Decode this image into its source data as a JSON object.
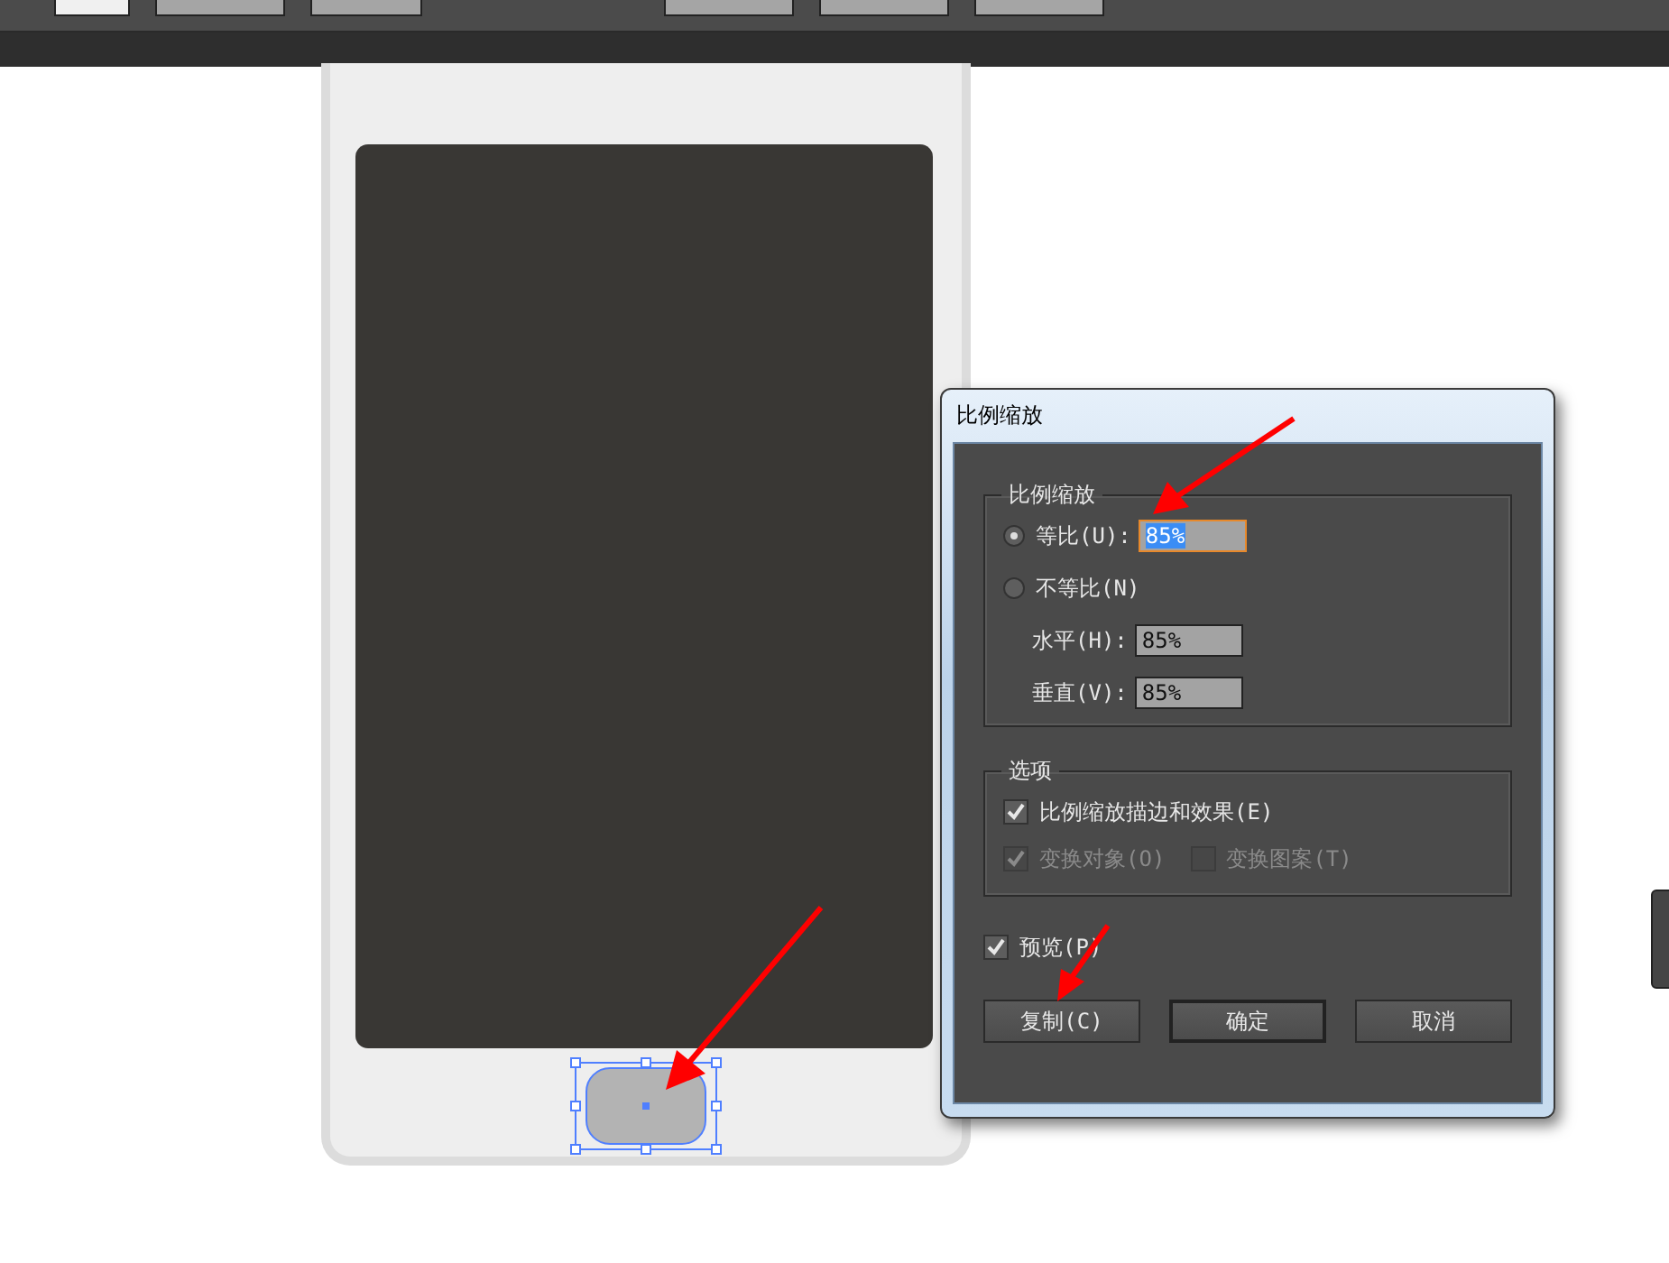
{
  "dialog": {
    "title": "比例缩放",
    "scale_group": {
      "legend": "比例缩放",
      "options": [
        {
          "kind": "uniform",
          "label": "等比(U):",
          "selected": true,
          "value": "85%"
        },
        {
          "kind": "nonuniform",
          "label": "不等比(N)",
          "selected": false
        }
      ],
      "fields": [
        {
          "label": "水平(H):",
          "value": "85%"
        },
        {
          "label": "垂直(V):",
          "value": "85%"
        }
      ]
    },
    "options_group": {
      "legend": "选项",
      "checkboxes": [
        {
          "label": "比例缩放描边和效果(E)",
          "checked": true,
          "disabled": false
        },
        {
          "label": "变换对象(O)",
          "checked": true,
          "disabled": true
        },
        {
          "label": "变换图案(T)",
          "checked": false,
          "disabled": true
        }
      ]
    },
    "preview": {
      "label": "预览(P)",
      "checked": true
    },
    "buttons": [
      {
        "label": "复制(C)",
        "default": false
      },
      {
        "label": "确定",
        "default": true
      },
      {
        "label": "取消",
        "default": false
      }
    ]
  }
}
